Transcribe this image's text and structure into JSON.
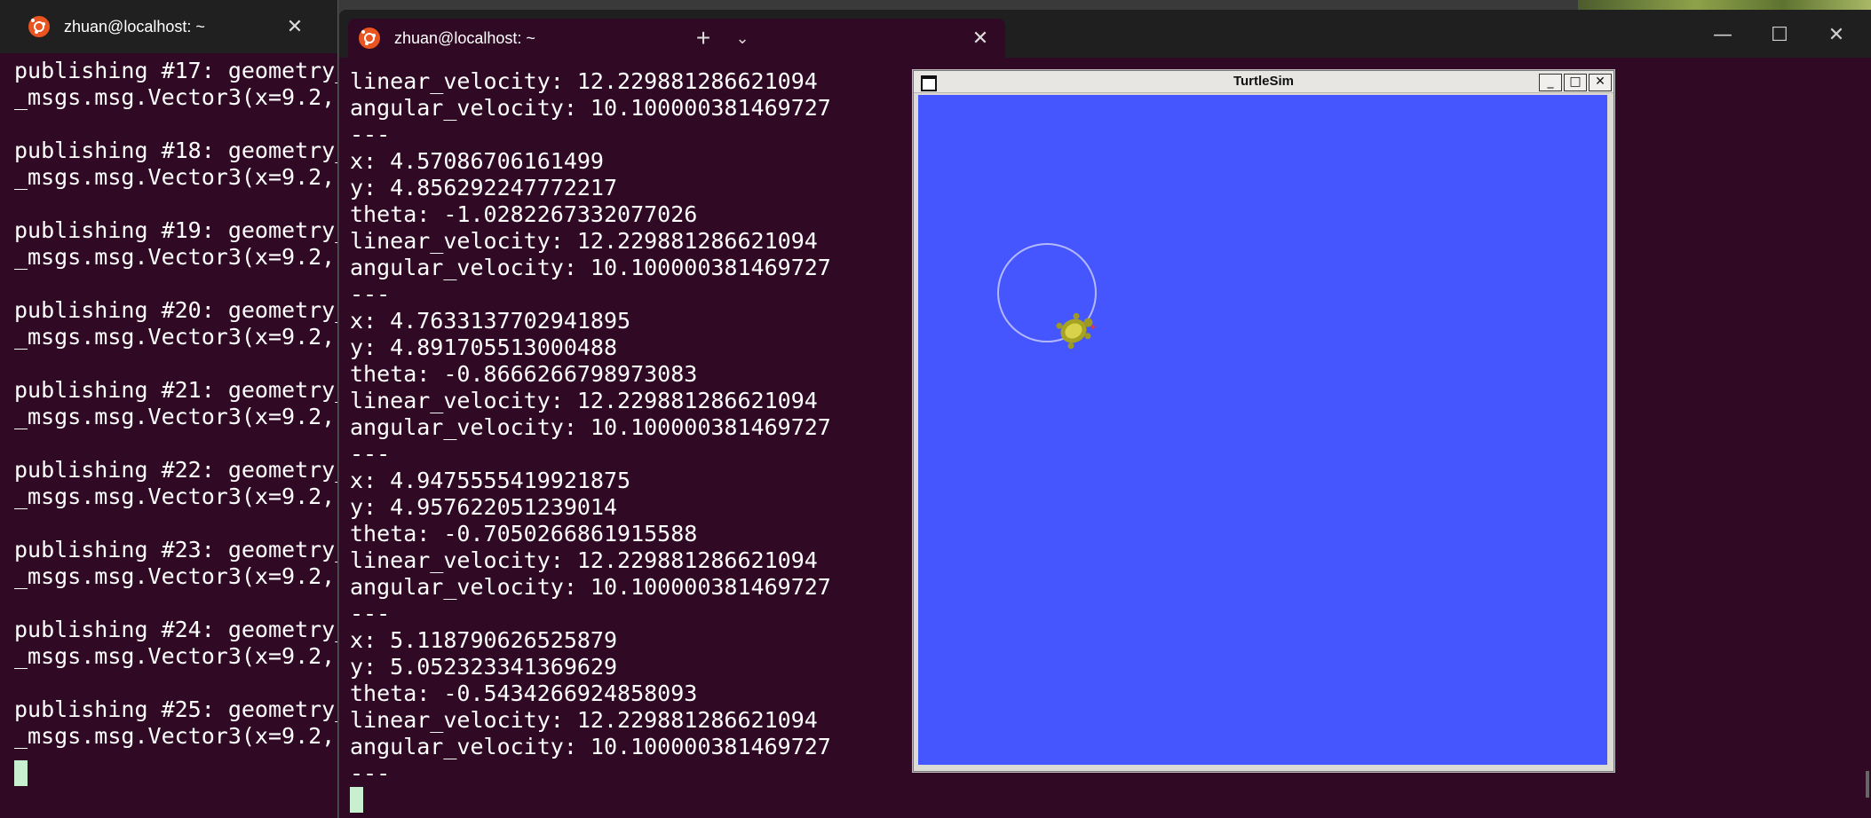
{
  "left_terminal": {
    "tab_title": "zhuan@localhost: ~",
    "lines": [
      "publishing #17: geometry_",
      "_msgs.msg.Vector3(x=9.2, ",
      "",
      "publishing #18: geometry_",
      "_msgs.msg.Vector3(x=9.2, ",
      "",
      "publishing #19: geometry_",
      "_msgs.msg.Vector3(x=9.2, ",
      "",
      "publishing #20: geometry_",
      "_msgs.msg.Vector3(x=9.2, ",
      "",
      "publishing #21: geometry_",
      "_msgs.msg.Vector3(x=9.2, ",
      "",
      "publishing #22: geometry_",
      "_msgs.msg.Vector3(x=9.2, ",
      "",
      "publishing #23: geometry_",
      "_msgs.msg.Vector3(x=9.2, ",
      "",
      "publishing #24: geometry_",
      "_msgs.msg.Vector3(x=9.2, ",
      "",
      "publishing #25: geometry_",
      "_msgs.msg.Vector3(x=9.2, "
    ]
  },
  "main_terminal": {
    "tab_title": "zhuan@localhost: ~",
    "new_tab_label": "+",
    "dropdown_label": "⌄",
    "lines": [
      "linear_velocity: 12.229881286621094",
      "angular_velocity: 10.100000381469727",
      "---",
      "x: 4.57086706161499",
      "y: 4.856292247772217",
      "theta: -1.0282267332077026",
      "linear_velocity: 12.229881286621094",
      "angular_velocity: 10.100000381469727",
      "---",
      "x: 4.7633137702941895",
      "y: 4.891705513000488",
      "theta: -0.8666266798973083",
      "linear_velocity: 12.229881286621094",
      "angular_velocity: 10.100000381469727",
      "---",
      "x: 4.9475555419921875",
      "y: 4.957622051239014",
      "theta: -0.7050266861915588",
      "linear_velocity: 12.229881286621094",
      "angular_velocity: 10.100000381469727",
      "---",
      "x: 5.118790626525879",
      "y: 5.052323341369629",
      "theta: -0.5434266924858093",
      "linear_velocity: 12.229881286621094",
      "angular_velocity: 10.100000381469727",
      "---"
    ]
  },
  "window_controls": {
    "minimize": "—",
    "maximize": "☐",
    "close": "✕"
  },
  "turtlesim": {
    "title": "TurtleSim",
    "min_label": "_",
    "max_label": "□",
    "close_label": "✕",
    "background_color": "#4556ff",
    "trail_color": "#b3b8ff"
  },
  "icons": {
    "terminal_app": "ubuntu-icon",
    "close": "close-icon",
    "new_tab": "plus-icon",
    "dropdown": "chevron-down-icon"
  }
}
